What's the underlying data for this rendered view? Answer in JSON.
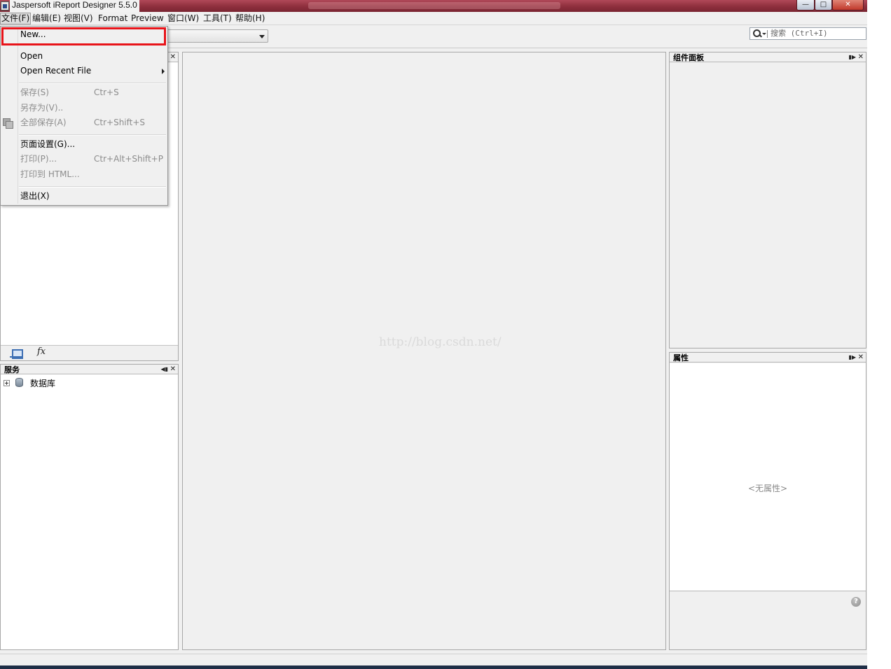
{
  "window": {
    "title": "Jaspersoft iReport Designer 5.5.0",
    "minimize_glyph": "—",
    "maximize_glyph": "□",
    "close_glyph": "✕"
  },
  "menubar": {
    "file": "文件(F)",
    "edit": "编辑(E)",
    "view": "视图(V)",
    "format": "Format",
    "preview": "Preview",
    "window": "窗口(W)",
    "tools": "工具(T)",
    "help": "帮助(H)"
  },
  "toolbar": {
    "search_placeholder": "搜索 (Ctrl+I)"
  },
  "file_menu": {
    "new": "New...",
    "open": "Open",
    "open_recent": "Open Recent File",
    "save": "保存(S)",
    "save_accel": "Ctr+S",
    "save_as": "另存为(V)..",
    "save_all": "全部保存(A)",
    "save_all_accel": "Ctr+Shift+S",
    "page_setup": "页面设置(G)...",
    "print": "打印(P)...",
    "print_accel": "Ctr+Alt+Shift+P",
    "print_html": "打印到 HTML...",
    "exit": "退出(X)"
  },
  "panels": {
    "left_bottom": {
      "title": "服务",
      "tree_items": [
        "数据库"
      ]
    },
    "right_top": {
      "title": "组件面板"
    },
    "right_bottom": {
      "title": "属性",
      "empty_text": "<无属性>"
    },
    "fx_label": "fx"
  },
  "center": {
    "watermark": "http://blog.csdn.net/"
  },
  "colors": {
    "titlebar": "#8e2f3d",
    "highlight_border": "#e8141a",
    "panel_background": "#f0f0f0"
  },
  "icons": [
    "app-icon",
    "search-icon",
    "save-all-icon",
    "database-icon",
    "expand-icon",
    "report-inspector-icon",
    "fx-icon",
    "help-icon",
    "close-icon",
    "minimize-icon"
  ]
}
